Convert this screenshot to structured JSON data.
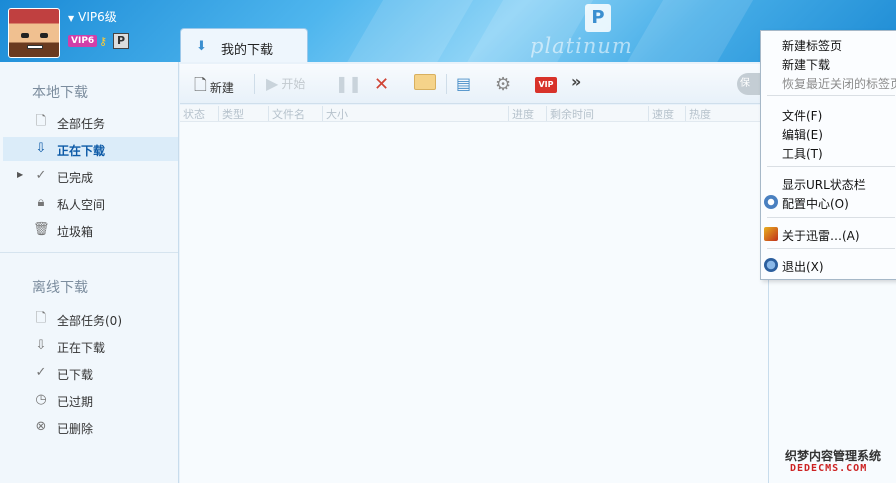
{
  "header": {
    "vip_level": "VIP6级",
    "vip_badge": "VIP6",
    "p_badge": "P",
    "logo_letter": "P",
    "brand_text": "platinum",
    "tab_label": "我的下载"
  },
  "sidebar": {
    "local_title": "本地下载",
    "local_items": [
      {
        "label": "全部任务",
        "icon": "file-icon"
      },
      {
        "label": "正在下载",
        "icon": "download-arrow-icon"
      },
      {
        "label": "已完成",
        "icon": "check-icon"
      },
      {
        "label": "私人空间",
        "icon": "lock-icon"
      },
      {
        "label": "垃圾箱",
        "icon": "trash-icon"
      }
    ],
    "offline_title": "离线下载",
    "offline_items": [
      {
        "label": "全部任务(0)",
        "icon": "file-icon"
      },
      {
        "label": "正在下载",
        "icon": "download-arrow-icon"
      },
      {
        "label": "已下载",
        "icon": "check-icon"
      },
      {
        "label": "已过期",
        "icon": "clock-icon"
      },
      {
        "label": "已删除",
        "icon": "delete-circle-icon"
      }
    ]
  },
  "toolbar": {
    "new_label": "新建",
    "start_label": "开始",
    "vip_label": "VIP",
    "more_label": "»",
    "edge_btn_label": "保"
  },
  "columns": [
    "状态",
    "类型",
    "文件名",
    "大小",
    "进度",
    "剩余时间",
    "速度",
    "热度"
  ],
  "menu": {
    "items": [
      {
        "label": "新建标签页",
        "disabled": false
      },
      {
        "label": "新建下载",
        "disabled": false
      },
      {
        "label": "恢复最近关闭的标签页",
        "disabled": true
      },
      {
        "label": "文件(F)",
        "disabled": false
      },
      {
        "label": "编辑(E)",
        "disabled": false
      },
      {
        "label": "工具(T)",
        "disabled": false
      },
      {
        "label": "显示URL状态栏",
        "disabled": false
      },
      {
        "label": "配置中心(O)",
        "disabled": false,
        "icon": "gear-icon"
      },
      {
        "label": "关于迅雷…(A)",
        "disabled": false,
        "icon": "thunder-icon"
      },
      {
        "label": "退出(X)",
        "disabled": false,
        "icon": "exit-icon"
      }
    ]
  },
  "watermark": {
    "line1": "织梦内容管理系统",
    "line2": "DEDECMS.COM"
  },
  "colors": {
    "header_blue": "#1a8ad6",
    "active_text": "#0d5aa7",
    "vip_pink": "#d23ea8",
    "vip_red": "#d8322a"
  }
}
